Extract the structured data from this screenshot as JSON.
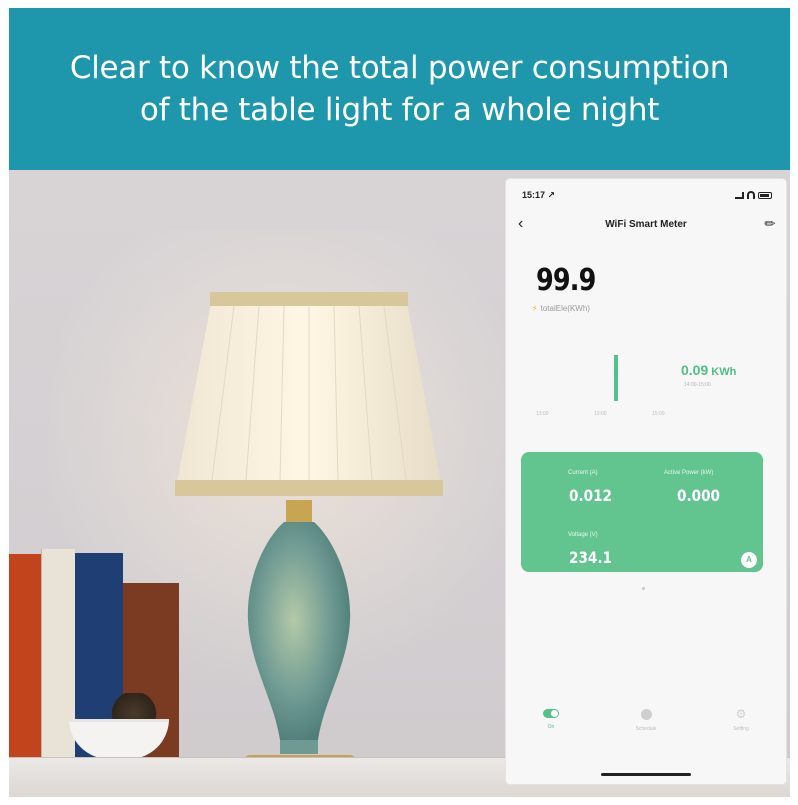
{
  "banner": {
    "line1": "Clear to know the total power consumption",
    "line2": "of the table light for a whole night"
  },
  "phone": {
    "status": {
      "time": "15:17 ↗"
    },
    "nav": {
      "back_icon": "‹",
      "title": "WiFi Smart Meter",
      "edit_icon": "✎"
    },
    "total": {
      "value": "99.9",
      "label": "totalEle(KWh)",
      "bolt_icon": "⚡"
    },
    "usage": {
      "value": "0.09",
      "unit": "KWh",
      "time_range": "14:00-15:00",
      "axis": [
        "13:00",
        "13:00",
        "15:00"
      ]
    },
    "card": {
      "current_label": "Current (A)",
      "current_value": "0.012",
      "power_label": "Active Power (kW)",
      "power_value": "0.000",
      "voltage_label": "Voltage (V)",
      "voltage_value": "234.1",
      "fab_label": "A"
    },
    "tabs": [
      {
        "label": "On"
      },
      {
        "label": "Schedule"
      },
      {
        "label": "Setting"
      }
    ]
  },
  "colors": {
    "banner": "#1e97ad",
    "accent_green": "#55c189",
    "card_green": "#62c48f"
  }
}
